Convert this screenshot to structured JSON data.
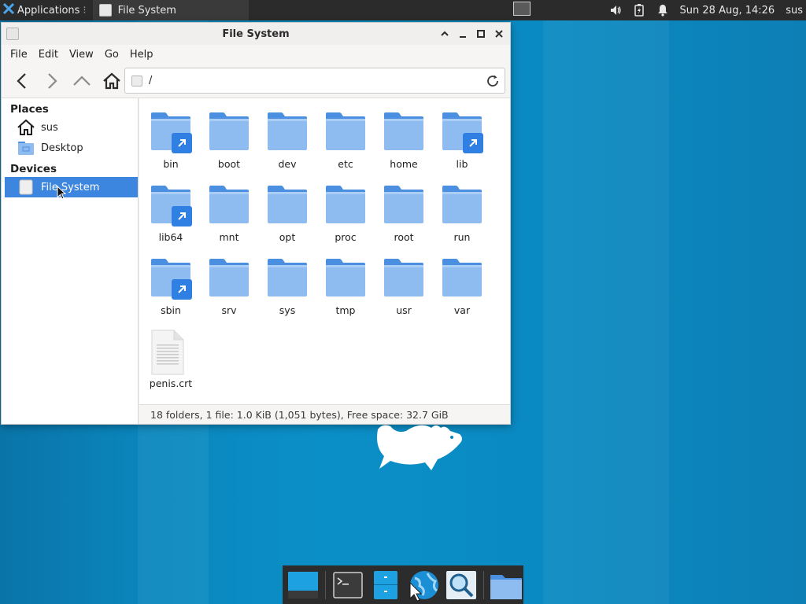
{
  "top_panel": {
    "applications_label": "Applications",
    "separator": "⁝",
    "task_label": "File System",
    "datetime": "Sun 28 Aug, 14:26",
    "user": "sus"
  },
  "window": {
    "title": "File System",
    "menu": [
      "File",
      "Edit",
      "View",
      "Go",
      "Help"
    ],
    "location_path": "/"
  },
  "sidebar": {
    "places_heading": "Places",
    "places": [
      {
        "label": "sus",
        "icon": "home-icon"
      },
      {
        "label": "Desktop",
        "icon": "desktop-folder-icon"
      }
    ],
    "devices_heading": "Devices",
    "devices": [
      {
        "label": "File System",
        "icon": "drive-icon",
        "selected": true
      }
    ]
  },
  "files": [
    {
      "name": "bin",
      "type": "folder",
      "symlink": true
    },
    {
      "name": "boot",
      "type": "folder",
      "symlink": false
    },
    {
      "name": "dev",
      "type": "folder",
      "symlink": false
    },
    {
      "name": "etc",
      "type": "folder",
      "symlink": false
    },
    {
      "name": "home",
      "type": "folder",
      "symlink": false
    },
    {
      "name": "lib",
      "type": "folder",
      "symlink": true
    },
    {
      "name": "lib64",
      "type": "folder",
      "symlink": true
    },
    {
      "name": "mnt",
      "type": "folder",
      "symlink": false
    },
    {
      "name": "opt",
      "type": "folder",
      "symlink": false
    },
    {
      "name": "proc",
      "type": "folder",
      "symlink": false
    },
    {
      "name": "root",
      "type": "folder",
      "symlink": false
    },
    {
      "name": "run",
      "type": "folder",
      "symlink": false
    },
    {
      "name": "sbin",
      "type": "folder",
      "symlink": true
    },
    {
      "name": "srv",
      "type": "folder",
      "symlink": false
    },
    {
      "name": "sys",
      "type": "folder",
      "symlink": false
    },
    {
      "name": "tmp",
      "type": "folder",
      "symlink": false
    },
    {
      "name": "usr",
      "type": "folder",
      "symlink": false
    },
    {
      "name": "var",
      "type": "folder",
      "symlink": false
    },
    {
      "name": "penis.crt",
      "type": "file",
      "symlink": false
    }
  ],
  "status_text": "18 folders, 1 file: 1.0 KiB (1,051 bytes), Free space: 32.7 GiB",
  "colors": {
    "folder_top": "#4a8fe0",
    "folder_body": "#8fbcf0",
    "selection": "#3d86e0",
    "badge": "#2f80e2",
    "panel": "#2b2b2b"
  }
}
